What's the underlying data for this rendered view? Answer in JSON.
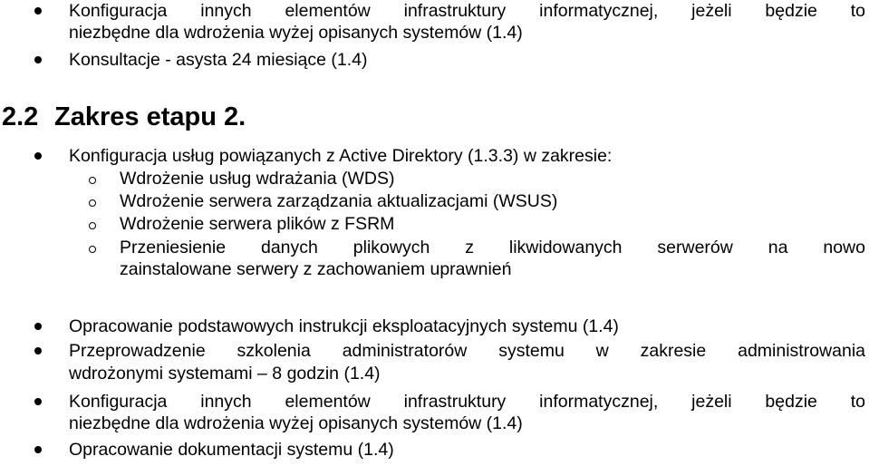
{
  "top_list": [
    {
      "lines": [
        "Konfiguracja innych elementów infrastruktury informatycznej, jeżeli będzie to",
        "niezbędne dla wdrożenia wyżej opisanych systemów (1.4)"
      ]
    },
    {
      "lines": [
        "Konsultacje - asysta 24 miesiące (1.4)"
      ]
    }
  ],
  "section": {
    "number": "2.2",
    "title": "Zakres etapu 2."
  },
  "main_list": [
    {
      "lines": [
        "Konfiguracja usług powiązanych z Active Direktory (1.3.3) w zakresie:"
      ],
      "subitems": [
        {
          "lines": [
            "Wdrożenie usług wdrażania (WDS)"
          ]
        },
        {
          "lines": [
            "Wdrożenie serwera zarządzania aktualizacjami (WSUS)"
          ]
        },
        {
          "lines": [
            "Wdrożenie serwera plików z FSRM"
          ]
        },
        {
          "lines": [
            "Przeniesienie danych plikowych z likwidowanych serwerów na nowo",
            "zainstalowane serwery z zachowaniem uprawnień"
          ]
        }
      ]
    },
    {
      "lines": [
        "Opracowanie podstawowych instrukcji eksploatacyjnych systemu (1.4)"
      ]
    },
    {
      "lines": [
        "Przeprowadzenie szkolenia administratorów systemu w zakresie administrowania",
        "wdrożonymi systemami – 8 godzin (1.4)"
      ]
    },
    {
      "lines": [
        "Konfiguracja innych elementów infrastruktury informatycznej, jeżeli będzie to",
        "niezbędne dla wdrożenia wyżej opisanych systemów (1.4)"
      ]
    },
    {
      "lines": [
        "Opracowanie dokumentacji systemu  (1.4)"
      ]
    }
  ]
}
